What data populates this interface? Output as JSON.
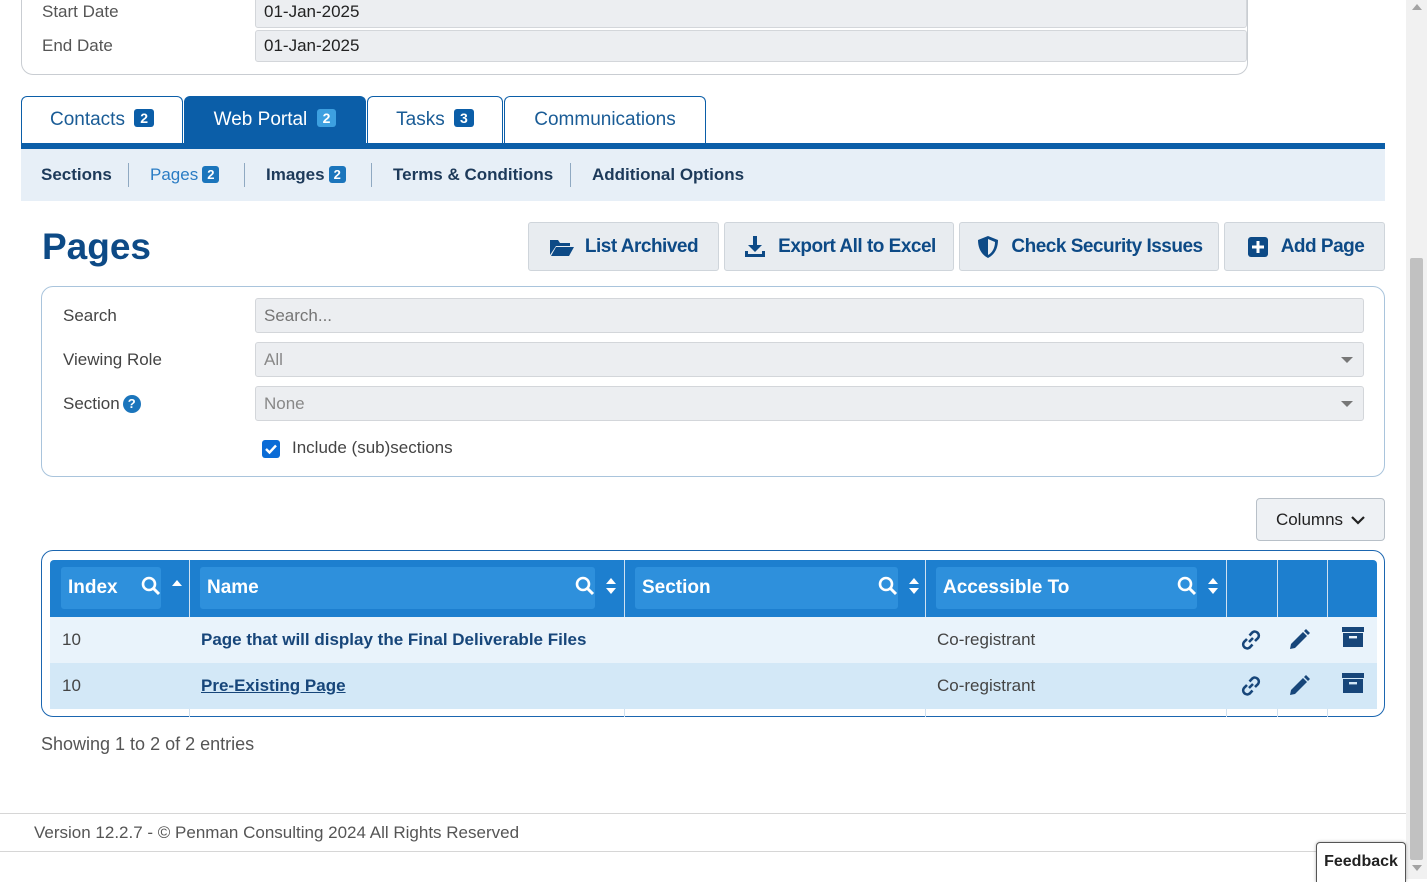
{
  "dates": {
    "start_label": "Start Date",
    "start_value": "01-Jan-2025",
    "end_label": "End Date",
    "end_value": "01-Jan-2025"
  },
  "tabs": [
    {
      "label": "Contacts",
      "count": "2"
    },
    {
      "label": "Web Portal",
      "count": "2"
    },
    {
      "label": "Tasks",
      "count": "3"
    },
    {
      "label": "Communications"
    }
  ],
  "subnav": [
    {
      "label": "Sections"
    },
    {
      "label": "Pages",
      "count": "2"
    },
    {
      "label": "Images",
      "count": "2"
    },
    {
      "label": "Terms & Conditions"
    },
    {
      "label": "Additional Options"
    }
  ],
  "page_title": "Pages",
  "toolbar": {
    "list_archived": "List Archived",
    "export_excel": "Export All to Excel",
    "check_security": "Check Security Issues",
    "add_page": "Add Page"
  },
  "filters": {
    "search_label": "Search",
    "search_placeholder": "Search...",
    "role_label": "Viewing Role",
    "role_value": "All",
    "section_label": "Section",
    "section_value": "None",
    "include_label": "Include (sub)sections",
    "include_checked": true
  },
  "columns_button": "Columns",
  "table": {
    "headers": [
      "Index",
      "Name",
      "Section",
      "Accessible To"
    ],
    "rows": [
      {
        "index": "10",
        "name": "Page that will display the Final Deliverable Files",
        "section": "",
        "accessible": "Co-registrant"
      },
      {
        "index": "10",
        "name": "Pre-Existing Page",
        "section": "",
        "accessible": "Co-registrant"
      }
    ]
  },
  "showing": "Showing 1 to 2 of 2 entries",
  "footer": "Version 12.2.7 - © Penman Consulting 2024 All Rights Reserved",
  "feedback": "Feedback",
  "icons": {
    "list_archived": "folder-open-icon",
    "export": "download-icon",
    "security": "shield-icon",
    "add": "plus-square-icon",
    "row_link": "link-icon",
    "row_edit": "pencil-icon",
    "row_archive": "archive-icon"
  },
  "colors": {
    "brand_dark": "#0b5ea8",
    "title": "#0d4a86",
    "header_bg": "#1d7fcf"
  }
}
